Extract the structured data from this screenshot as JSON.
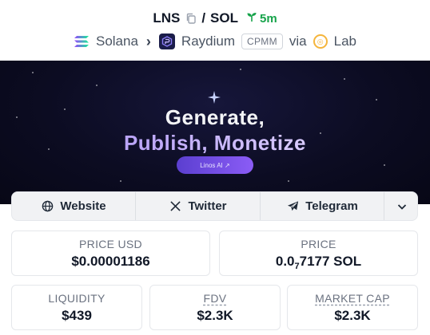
{
  "header": {
    "base_token": "LNS",
    "slash": "/",
    "quote_token": "SOL",
    "age": "5m",
    "chain": "Solana",
    "dex": "Raydium",
    "pool_type": "CPMM",
    "via": "via",
    "launchpad": "Lab"
  },
  "banner": {
    "line1": "Generate,",
    "line2": "Publish, Monetize",
    "button": "Linos AI ↗"
  },
  "links": {
    "website": "Website",
    "twitter": "Twitter",
    "telegram": "Telegram"
  },
  "stats": {
    "price_usd_label": "PRICE USD",
    "price_usd_value": "$0.00001186",
    "price_label": "PRICE",
    "price_value_prefix": "0.0",
    "price_value_zeros": "7",
    "price_value_suffix": "7177 SOL",
    "liquidity_label": "LIQUIDITY",
    "liquidity_value": "$439",
    "fdv_label": "FDV",
    "fdv_value": "$2.3K",
    "mcap_label": "MARKET CAP",
    "mcap_value": "$2.3K"
  },
  "colors": {
    "age_green": "#16a34a",
    "banner_bg": "#0c0c22",
    "accent_purple": "#8b5cf6"
  },
  "icons": {
    "copy": "copy-icon",
    "sprout": "sprout-icon",
    "solana": "solana-logo-icon",
    "raydium": "raydium-logo-icon",
    "lab": "lab-logo-icon",
    "globe": "globe-icon",
    "x": "x-twitter-icon",
    "telegram": "telegram-icon",
    "chevron": "chevron-down-icon"
  }
}
